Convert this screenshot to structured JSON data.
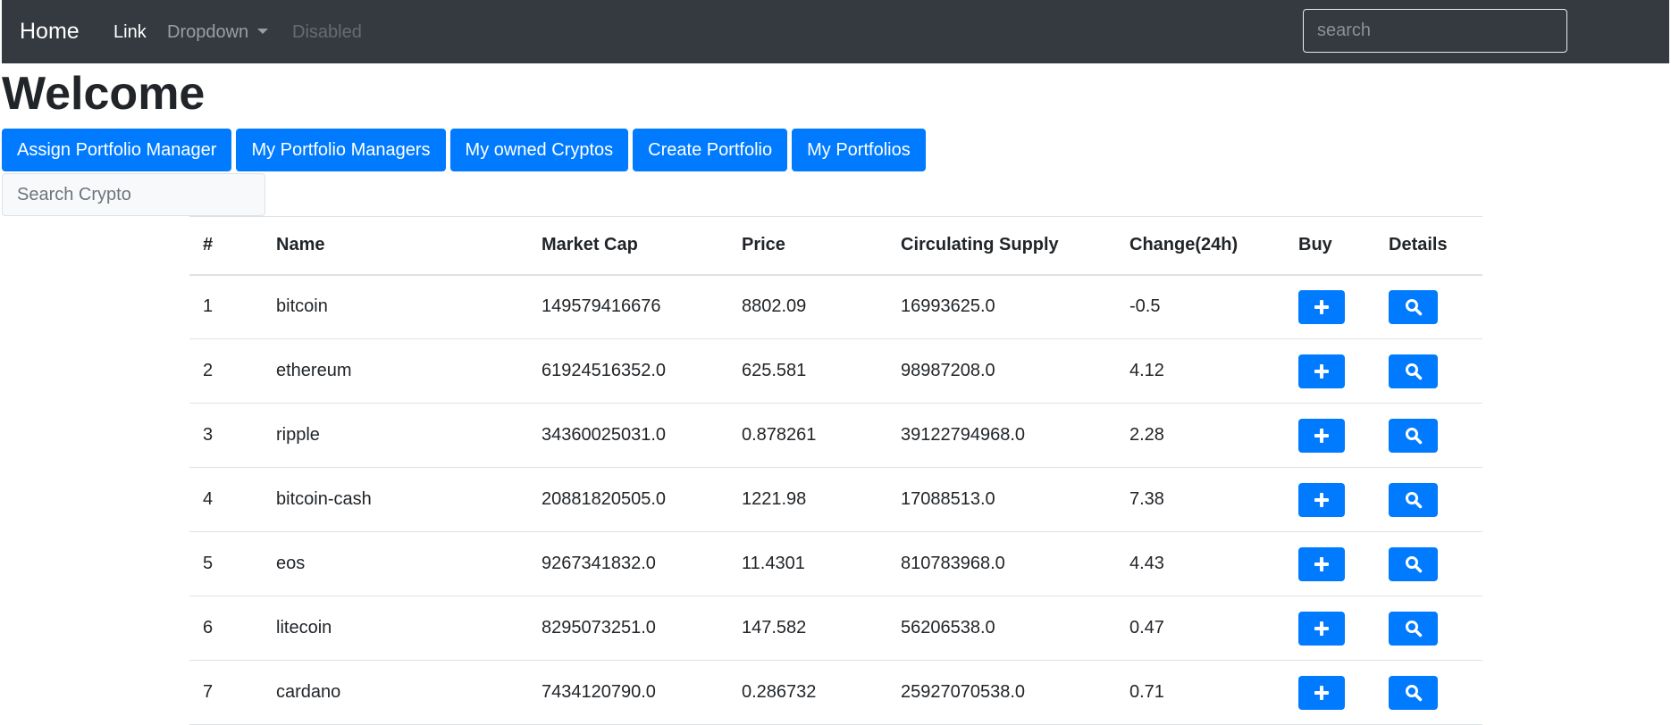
{
  "navbar": {
    "brand": "Home",
    "links": [
      "Link",
      "Dropdown",
      "Disabled"
    ],
    "search_placeholder": "search"
  },
  "page": {
    "title": "Welcome"
  },
  "actions": [
    "Assign Portfolio Manager",
    "My Portfolio Managers",
    "My owned Cryptos",
    "Create Portfolio",
    "My Portfolios"
  ],
  "crypto_search": {
    "placeholder": "Search Crypto"
  },
  "table": {
    "headers": [
      "#",
      "Name",
      "Market Cap",
      "Price",
      "Circulating Supply",
      "Change(24h)",
      "Buy",
      "Details"
    ],
    "rows": [
      [
        "1",
        "bitcoin",
        "149579416676",
        "8802.09",
        "16993625.0",
        "-0.5"
      ],
      [
        "2",
        "ethereum",
        "61924516352.0",
        "625.581",
        "98987208.0",
        "4.12"
      ],
      [
        "3",
        "ripple",
        "34360025031.0",
        "0.878261",
        "39122794968.0",
        "2.28"
      ],
      [
        "4",
        "bitcoin-cash",
        "20881820505.0",
        "1221.98",
        "17088513.0",
        "7.38"
      ],
      [
        "5",
        "eos",
        "9267341832.0",
        "11.4301",
        "810783968.0",
        "4.43"
      ],
      [
        "6",
        "litecoin",
        "8295073251.0",
        "147.582",
        "56206538.0",
        "0.47"
      ],
      [
        "7",
        "cardano",
        "7434120790.0",
        "0.286732",
        "25927070538.0",
        "0.71"
      ]
    ],
    "buy_icon": "plus-icon",
    "details_icon": "search-icon"
  },
  "colors": {
    "navbar_bg": "#343a40",
    "primary": "#007bff"
  }
}
